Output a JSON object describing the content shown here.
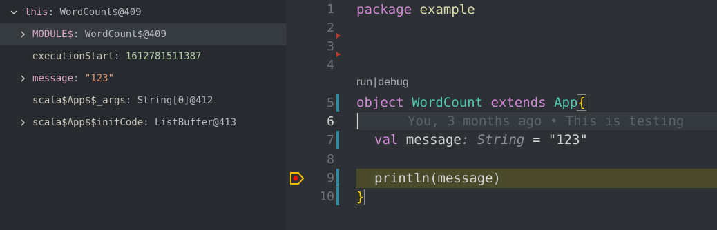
{
  "variables": [
    {
      "name": "this",
      "value": "WordCount$@409",
      "expanded": true,
      "depth": 0,
      "kind": "obj"
    },
    {
      "name": "MODULE$",
      "value": "WordCount$@409",
      "expanded": false,
      "depth": 1,
      "kind": "obj",
      "selected": true
    },
    {
      "name": "executionStart",
      "value": "1612781511387",
      "depth": 1,
      "kind": "num"
    },
    {
      "name": "message",
      "value": "\"123\"",
      "expanded": false,
      "depth": 1,
      "kind": "str"
    },
    {
      "name": "scala$App$$_args",
      "value": "String[0]@412",
      "depth": 1,
      "kind": "obj"
    },
    {
      "name": "scala$App$$initCode",
      "value": "ListBuffer@413",
      "expanded": false,
      "depth": 1,
      "kind": "obj"
    }
  ],
  "editor": {
    "line_numbers": [
      "1",
      "2",
      "3",
      "4",
      "5",
      "6",
      "7",
      "8",
      "9",
      "10"
    ],
    "active_line": "6",
    "code": {
      "l1_kw": "package",
      "l1_id": "example",
      "l5_kw1": "object",
      "l5_ty": "WordCount",
      "l5_kw2": "extends",
      "l5_ty2": "App",
      "l5_brace": "{",
      "l7_kw": "val",
      "l7_name": "message",
      "l7_type": ": String",
      "l7_eq": " = ",
      "l7_str": "\"123\"",
      "l9_call": "println(message)",
      "l10_brace": "}"
    },
    "codelens": {
      "run": "run",
      "sep": "|",
      "debug": "debug"
    },
    "blame": "You, 3 months ago • This is testing"
  },
  "colors": {
    "accent": "#2e8ca3",
    "highlight": "#4a4a2a",
    "breakpoint": "#f0c000"
  }
}
